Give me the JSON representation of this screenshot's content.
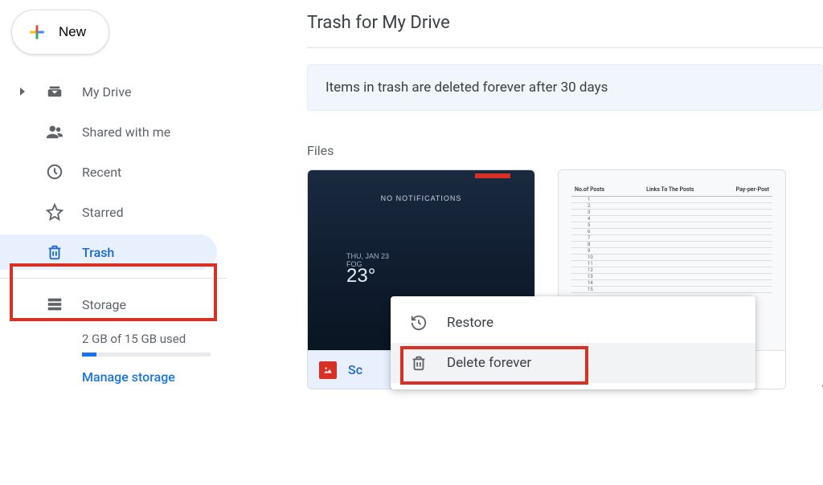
{
  "sidebar": {
    "new_label": "New",
    "items": [
      {
        "label": "My Drive",
        "icon": "drive-icon",
        "has_children": true
      },
      {
        "label": "Shared with me",
        "icon": "people-icon",
        "has_children": false
      },
      {
        "label": "Recent",
        "icon": "clock-icon",
        "has_children": false
      },
      {
        "label": "Starred",
        "icon": "star-icon",
        "has_children": false
      },
      {
        "label": "Trash",
        "icon": "trash-icon",
        "has_children": false,
        "active": true
      }
    ],
    "storage": {
      "label": "Storage",
      "text": "2 GB of 15 GB used",
      "used_gb": 2,
      "total_gb": 15,
      "percent": 13,
      "manage_label": "Manage storage"
    }
  },
  "main": {
    "title": "Trash for My Drive",
    "banner": "Items in trash are deleted forever after 30 days",
    "section_header": "Files",
    "files": [
      {
        "name_prefix": "Sc",
        "type": "image",
        "selected": true,
        "thumb": {
          "notif_text": "NO NOTIFICATIONS",
          "date_text": "THU, JAN 23",
          "condition_text": "FOG",
          "temp_text": "23°"
        }
      },
      {
        "name_prefix": "",
        "type": "spreadsheet",
        "selected": false,
        "thumb": {
          "col1": "No.of Posts",
          "col2": "Links To The Posts",
          "col3": "Pay-per-Post"
        }
      }
    ]
  },
  "context_menu": {
    "items": [
      {
        "label": "Restore",
        "icon": "restore-icon"
      },
      {
        "label": "Delete forever",
        "icon": "trash-outline-icon",
        "highlighted": true
      }
    ]
  },
  "annotations": {
    "trash_highlighted": true,
    "delete_forever_highlighted": true,
    "highlight_color": "#d93025"
  }
}
